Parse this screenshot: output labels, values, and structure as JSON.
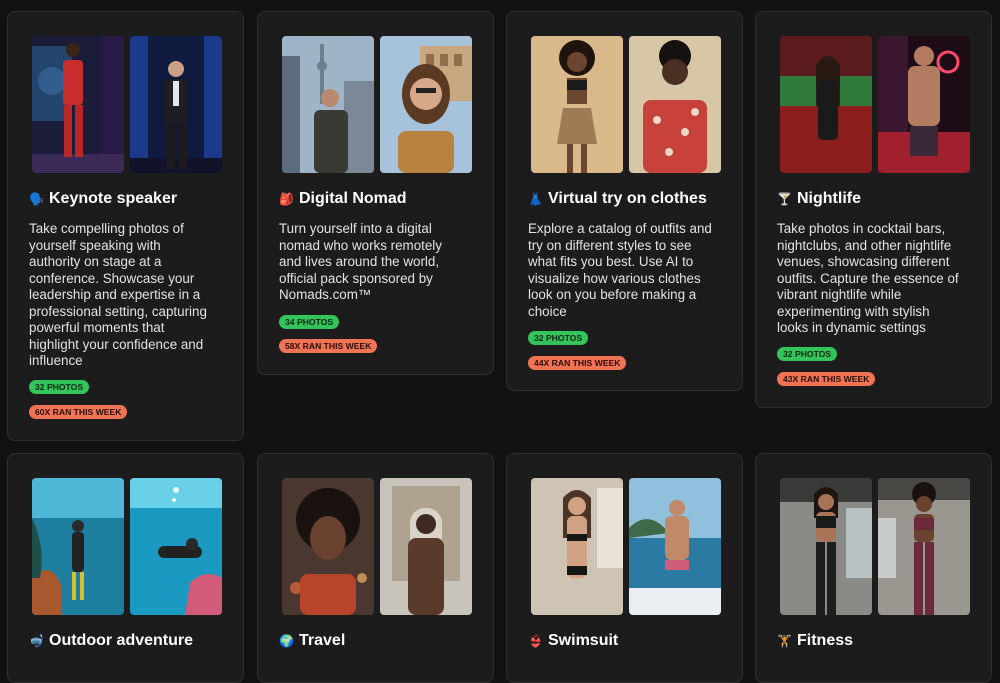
{
  "cards": [
    {
      "icon": "🗣️",
      "title": "Keynote speaker",
      "description": "Take compelling photos of\nyourself speaking with\nauthority on stage at a\nconference. Showcase your\nleadership and expertise in a\nprofessional setting, capturing\npowerful moments that\nhighlight your confidence and\ninfluence",
      "photos_badge": "32 PHOTOS",
      "ran_badge": "60X RAN THIS WEEK"
    },
    {
      "icon": "🎒",
      "title": "Digital Nomad",
      "description": "Turn yourself into a digital\nnomad who works remotely\nand lives around the world,\nofficial pack sponsored by\nNomads.com™",
      "photos_badge": "34 PHOTOS",
      "ran_badge": "58X RAN THIS WEEK"
    },
    {
      "icon": "👗",
      "title": "Virtual try on clothes",
      "description": "Explore a catalog of outfits and\ntry on different styles to see\nwhat fits you best. Use AI to\nvisualize how various clothes\nlook on you before making a\nchoice",
      "photos_badge": "32 PHOTOS",
      "ran_badge": "44X RAN THIS WEEK"
    },
    {
      "icon": "🍸",
      "title": "Nightlife",
      "description": "Take photos in cocktail bars,\nnightclubs, and other nightlife\nvenues, showcasing different\noutfits. Capture the essence of\nvibrant nightlife while\nexperimenting with stylish\nlooks in dynamic settings",
      "photos_badge": "32 PHOTOS",
      "ran_badge": "43X RAN THIS WEEK"
    },
    {
      "icon": "🤿",
      "title": "Outdoor adventure"
    },
    {
      "icon": "🌍",
      "title": "Travel"
    },
    {
      "icon": "👙",
      "title": "Swimsuit"
    },
    {
      "icon": "🏋️",
      "title": "Fitness"
    }
  ],
  "colors": {
    "background": "#121212",
    "card": "#1c1c1c",
    "photos_badge": "#33c45c",
    "ran_badge": "#f07355"
  }
}
